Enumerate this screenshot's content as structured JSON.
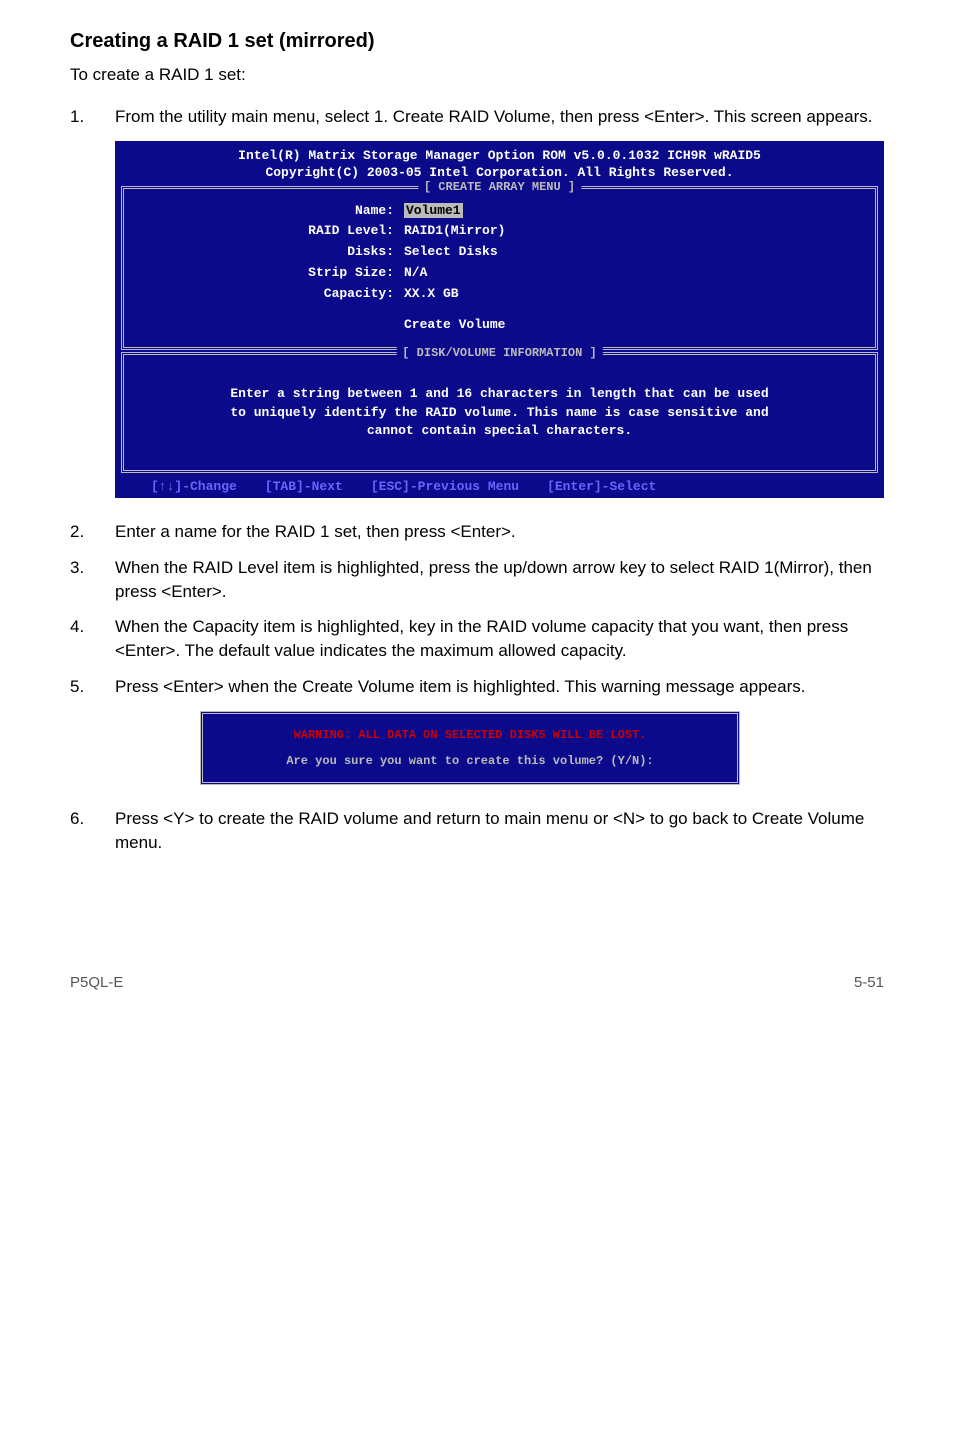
{
  "heading": "Creating a RAID 1 set (mirrored)",
  "intro": "To create a RAID 1 set:",
  "steps": {
    "s1": {
      "num": "1.",
      "txt": "From the utility main menu, select 1. Create RAID Volume, then press <Enter>. This screen appears."
    },
    "s2": {
      "num": "2.",
      "txt": "Enter a name for the RAID 1 set, then press <Enter>."
    },
    "s3": {
      "num": "3.",
      "txt": "When the RAID Level item is highlighted, press the up/down arrow key to select RAID 1(Mirror), then press <Enter>."
    },
    "s4": {
      "num": "4.",
      "txt": "When the Capacity item is highlighted, key in the RAID volume capacity that you want, then press <Enter>. The default value indicates the maximum allowed capacity."
    },
    "s5": {
      "num": "5.",
      "txt": "Press <Enter> when the Create Volume item is highlighted. This warning message appears."
    },
    "s6": {
      "num": "6.",
      "txt": "Press <Y> to create the RAID volume and return to main menu or <N> to go back to Create Volume menu."
    }
  },
  "bios": {
    "title1": "Intel(R) Matrix Storage Manager Option ROM v5.0.0.1032 ICH9R wRAID5",
    "title2": "Copyright(C) 2003-05 Intel Corporation. All Rights Reserved.",
    "sec1": "[ CREATE ARRAY MENU ]",
    "sec2": "[ DISK/VOLUME INFORMATION ]",
    "form": {
      "name_l": "Name:",
      "name_v": "Volume1",
      "level_l": "RAID Level:",
      "level_v": "RAID1(Mirror)",
      "disks_l": "Disks:",
      "disks_v": "Select Disks",
      "strip_l": "Strip Size:",
      "strip_v": "N/A",
      "cap_l": "Capacity:",
      "cap_v": "XX.X  GB",
      "create": "Create Volume"
    },
    "info1": "Enter a string between 1 and 16 characters in length that can be used",
    "info2": "to uniquely identify the RAID volume. This name is case sensitive and",
    "info3": "cannot contain special characters.",
    "bb1": "[↑↓]-Change",
    "bb2": "[TAB]-Next",
    "bb3": "[ESC]-Previous Menu",
    "bb4": "[Enter]-Select"
  },
  "warn": {
    "line1": "WARNING: ALL DATA ON SELECTED DISKS WILL BE LOST.",
    "line2": "Are you sure you want to create this volume? (Y/N):"
  },
  "footer": {
    "left": "P5QL-E",
    "right": "5-51"
  }
}
